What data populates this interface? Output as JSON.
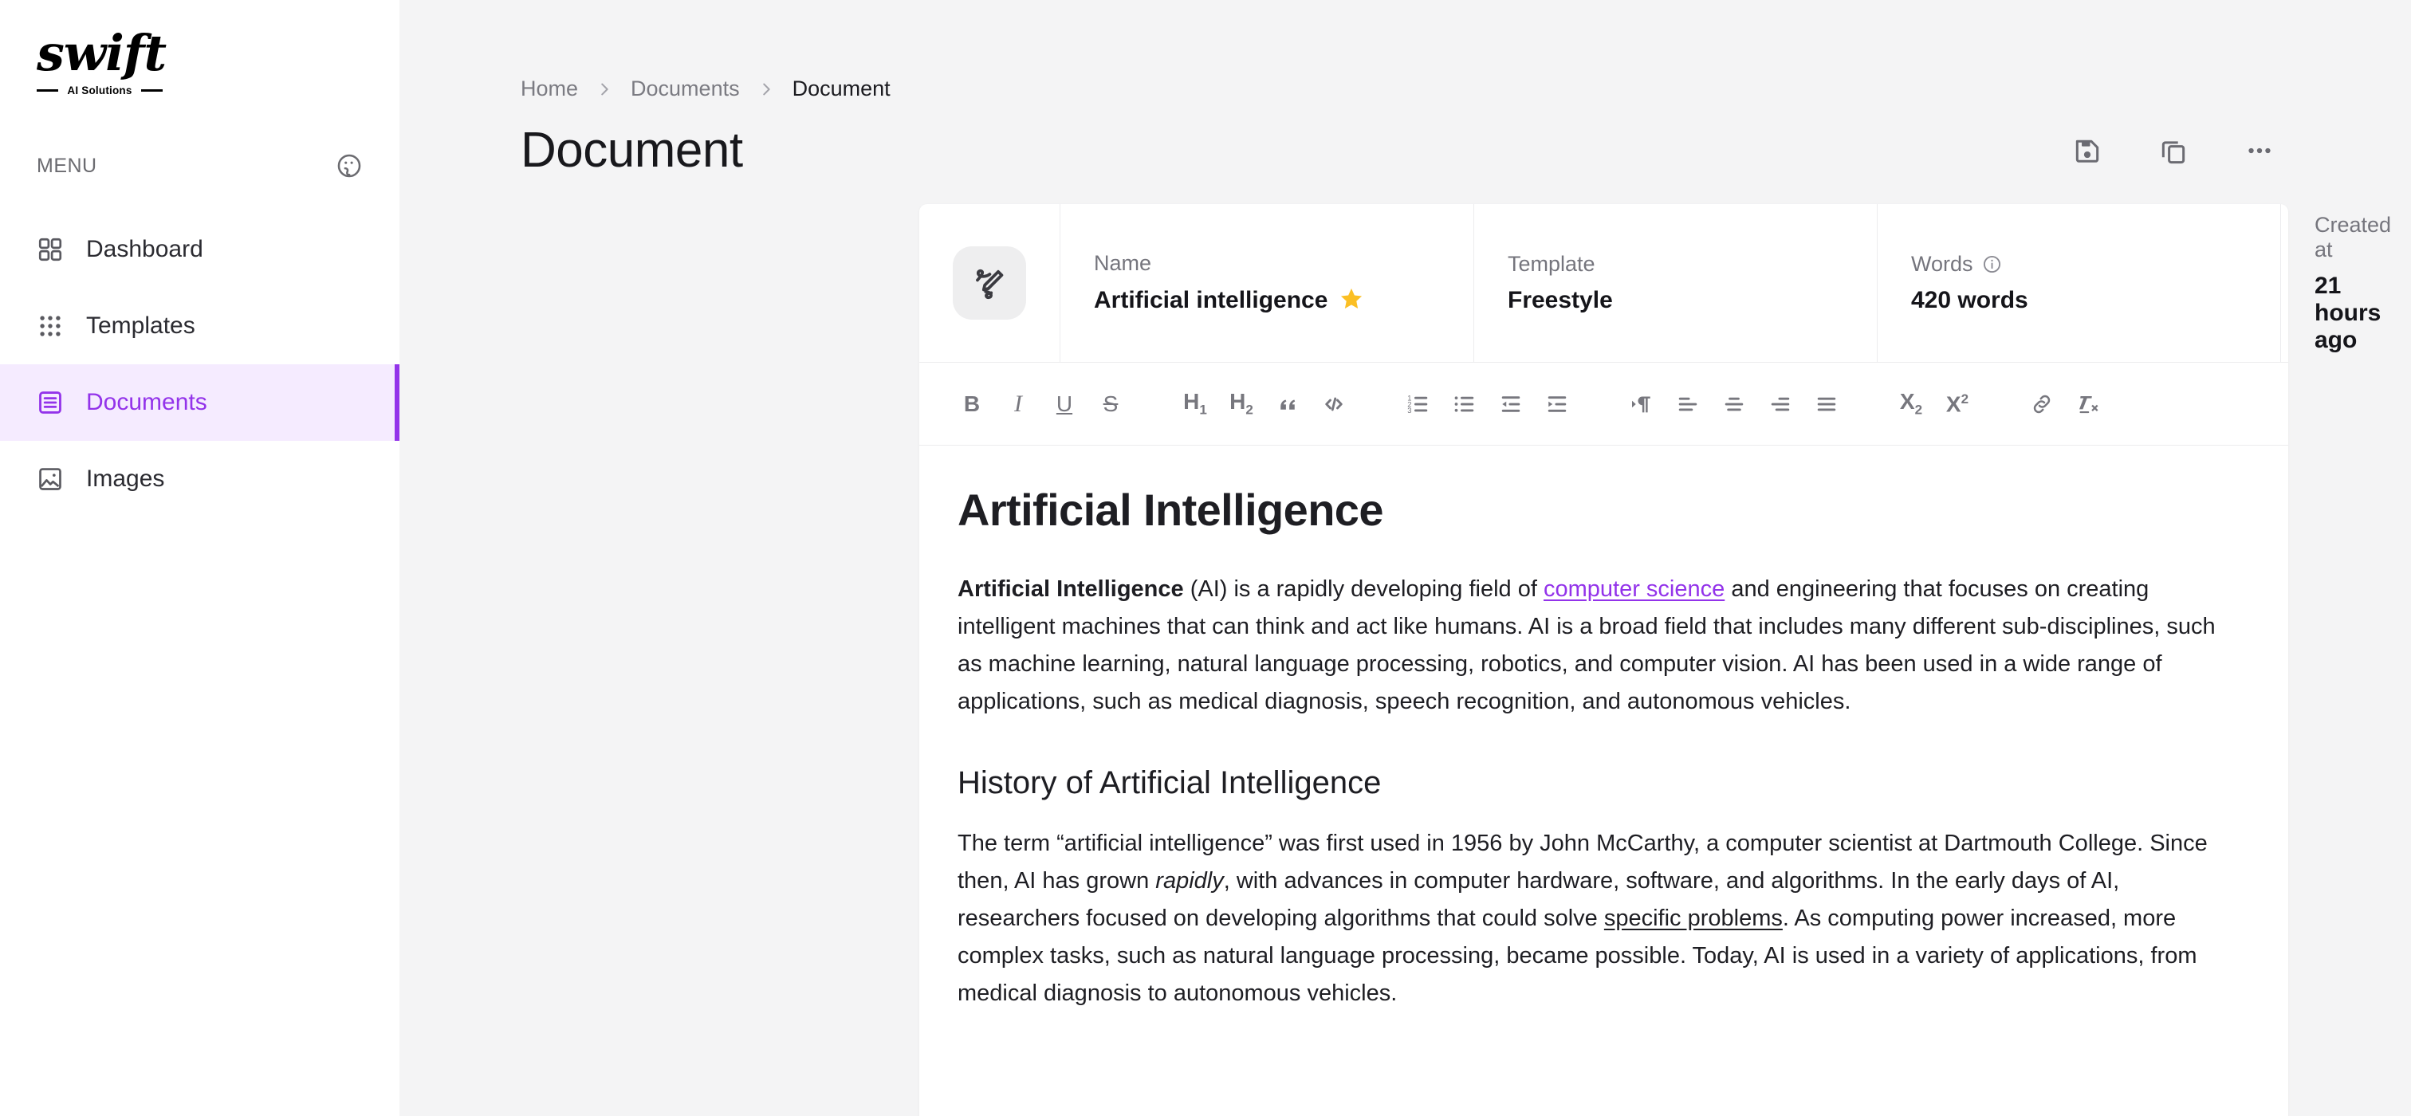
{
  "brand": {
    "word": "swift",
    "tagline": "AI Solutions"
  },
  "sidebar": {
    "menu_label": "MENU",
    "theme_icon": "palette-icon",
    "items": [
      {
        "label": "Dashboard",
        "icon": "grid-2x2-icon",
        "active": false
      },
      {
        "label": "Templates",
        "icon": "grid-3x3-dots-icon",
        "active": false
      },
      {
        "label": "Documents",
        "icon": "document-list-icon",
        "active": true
      },
      {
        "label": "Images",
        "icon": "image-icon",
        "active": false
      }
    ],
    "accent_color": "#9333ea",
    "active_bg": "#f5ebff"
  },
  "breadcrumb": {
    "items": [
      "Home",
      "Documents",
      "Document"
    ],
    "separator": "chevron-right-icon"
  },
  "header": {
    "title": "Document",
    "actions": [
      {
        "name": "save-button",
        "icon": "floppy-disk-icon"
      },
      {
        "name": "duplicate-button",
        "icon": "copy-icon"
      },
      {
        "name": "more-options-button",
        "icon": "ellipsis-icon"
      }
    ]
  },
  "meta": {
    "doc_icon": "pen-signature-icon",
    "name": {
      "label": "Name",
      "value": "Artificial intelligence",
      "starred": true,
      "star_color": "#fbbf24"
    },
    "template": {
      "label": "Template",
      "value": "Freestyle"
    },
    "words": {
      "label": "Words",
      "value": "420 words",
      "info_icon": "info-circle-icon"
    },
    "created": {
      "label": "Created at",
      "value": "21 hours ago"
    }
  },
  "toolbar": {
    "groups": [
      [
        {
          "name": "bold-button",
          "glyph": "B",
          "kind": "bold"
        },
        {
          "name": "italic-button",
          "glyph": "I",
          "kind": "italic"
        },
        {
          "name": "underline-button",
          "glyph": "U",
          "kind": "underline"
        },
        {
          "name": "strikethrough-button",
          "glyph": "S",
          "kind": "strike"
        }
      ],
      [
        {
          "name": "heading-1-button",
          "glyph": "H1",
          "kind": "h1"
        },
        {
          "name": "heading-2-button",
          "glyph": "H2",
          "kind": "h2"
        },
        {
          "name": "blockquote-button",
          "glyph": "”",
          "kind": "quote"
        },
        {
          "name": "code-block-button",
          "glyph": "</>",
          "kind": "code"
        }
      ],
      [
        {
          "name": "ordered-list-button",
          "icon": "ordered-list-icon"
        },
        {
          "name": "bullet-list-button",
          "icon": "bullet-list-icon"
        },
        {
          "name": "outdent-button",
          "icon": "outdent-icon"
        },
        {
          "name": "indent-button",
          "icon": "indent-icon"
        }
      ],
      [
        {
          "name": "text-direction-button",
          "icon": "paragraph-direction-icon"
        },
        {
          "name": "align-left-button",
          "icon": "align-left-icon"
        },
        {
          "name": "align-center-button",
          "icon": "align-center-icon"
        },
        {
          "name": "align-right-button",
          "icon": "align-right-icon"
        },
        {
          "name": "align-justify-button",
          "icon": "align-justify-icon"
        }
      ],
      [
        {
          "name": "subscript-button",
          "glyph": "x2",
          "kind": "sub"
        },
        {
          "name": "superscript-button",
          "glyph": "x2",
          "kind": "sup"
        }
      ],
      [
        {
          "name": "insert-link-button",
          "icon": "link-icon"
        },
        {
          "name": "clear-formatting-button",
          "icon": "clear-format-icon"
        }
      ]
    ]
  },
  "document": {
    "h1": "Artificial Intelligence",
    "p1": {
      "lead": "Artificial Intelligence",
      "before_link": " (AI) is a rapidly developing field of ",
      "link": "computer science",
      "after_link": " and engineering that focuses on creating intelligent machines that can think and act like humans. AI is a broad field that includes many different sub-disciplines, such as machine learning, natural language processing, robotics, and computer vision. AI has been used in a wide range of applications, such as medical diagnosis, speech recognition, and autonomous vehicles."
    },
    "h2": "History of Artificial Intelligence",
    "p2": {
      "part1": "The term “artificial intelligence” was first used in 1956 by John McCarthy, a computer scientist at Dartmouth College. Since then, AI has grown ",
      "italic": "rapidly",
      "part2": ", with advances in computer hardware, software, and algorithms. In the early days of AI, researchers focused on developing algorithms that could solve ",
      "underline": "specific problems",
      "part3": ". As computing power increased, more complex tasks, such as natural language processing, became possible. Today, AI is used in a variety of applications, from medical diagnosis to autonomous vehicles."
    }
  }
}
